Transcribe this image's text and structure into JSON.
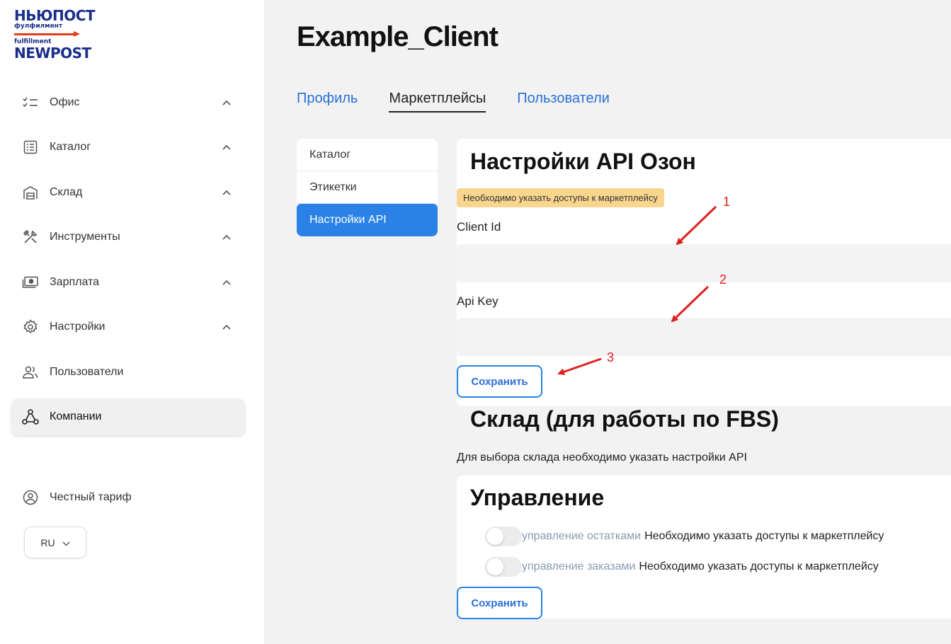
{
  "logo": {
    "line1": "НЬЮПОСТ",
    "line2": "фулфилмент",
    "line3": "fulfillment",
    "line4": "NEWPOST"
  },
  "sidebar": {
    "items": [
      {
        "label": "Офис",
        "icon": "checklist-icon",
        "has_chevron": true
      },
      {
        "label": "Каталог",
        "icon": "list-box-icon",
        "has_chevron": true
      },
      {
        "label": "Склад",
        "icon": "warehouse-icon",
        "has_chevron": true
      },
      {
        "label": "Инструменты",
        "icon": "tools-icon",
        "has_chevron": true
      },
      {
        "label": "Зарплата",
        "icon": "money-icon",
        "has_chevron": true
      },
      {
        "label": "Настройки",
        "icon": "gear-icon",
        "has_chevron": true
      },
      {
        "label": "Пользователи",
        "icon": "users-icon",
        "has_chevron": false
      },
      {
        "label": "Компании",
        "icon": "company-network-icon",
        "has_chevron": false,
        "active": true
      }
    ],
    "tariff": "Честный тариф",
    "lang": "RU"
  },
  "header": {
    "title": "Example_Client"
  },
  "tabs": [
    "Профиль",
    "Маркетплейсы",
    "Пользователи"
  ],
  "active_tab": "Маркетплейсы",
  "subnav": [
    "Каталог",
    "Этикетки",
    "Настройки API"
  ],
  "active_subnav": "Настройки API",
  "api": {
    "title": "Настройки API Озон",
    "warning": "Необходимо указать доступы к маркетплейсу",
    "client_id_label": "Client Id",
    "client_id_value": "",
    "api_key_label": "Api Key",
    "api_key_value": "",
    "save": "Сохранить"
  },
  "fbs": {
    "title": "Склад (для работы по FBS)",
    "note": "Для выбора склада необходимо указать настройки API"
  },
  "management": {
    "title": "Управление",
    "toggles": [
      {
        "label": "управление остатками",
        "note": "Необходимо указать доступы к маркетплейсу",
        "on": false
      },
      {
        "label": "управление заказами",
        "note": "Необходимо указать доступы к маркетплейсу",
        "on": false
      }
    ],
    "save": "Сохранить"
  },
  "annotations": [
    "1",
    "2",
    "3"
  ],
  "colors": {
    "accent": "#2a82e6",
    "link": "#2a6fd6",
    "warning_bg": "#f9d68e",
    "annotation": "#e02020"
  }
}
